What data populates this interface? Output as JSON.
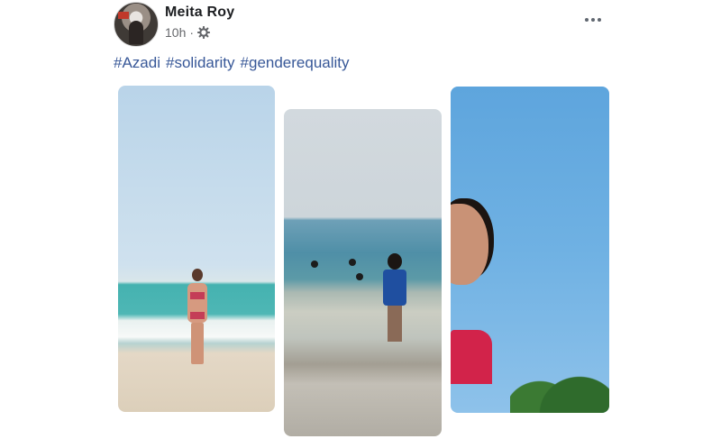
{
  "post": {
    "author": "Meita Roy",
    "time": "10h",
    "separator": "·",
    "privacy_icon": "gear-icon",
    "more_icon": "more-options-icon",
    "hashtags": [
      "#Azadi",
      "#solidarity",
      "#genderequality"
    ],
    "link_color": "#385898"
  },
  "photos": [
    {
      "description_icon": "beach-photo-1"
    },
    {
      "description_icon": "beach-photo-2"
    },
    {
      "description_icon": "beach-photo-3"
    }
  ]
}
